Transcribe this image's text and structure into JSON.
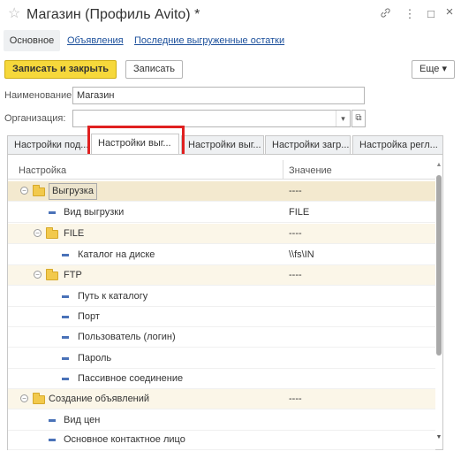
{
  "window": {
    "title": "Магазин (Профиль Avito) *",
    "star_icon": "☆",
    "link_icon": "🔗",
    "menu_icon": "⋮",
    "maximize_icon": "□",
    "close_icon": "×"
  },
  "nav": {
    "main": "Основное",
    "ads": "Объявления",
    "last_stock": "Последние выгруженные остатки"
  },
  "toolbar": {
    "save_close": "Записать и закрыть",
    "save": "Записать",
    "more": "Еще ▾"
  },
  "fields": {
    "name_label": "Наименование:",
    "name_value": "Магазин",
    "org_label": "Организация:",
    "org_value": "",
    "dropdown_icon": "▾",
    "open_icon": "⧉"
  },
  "tabs": [
    {
      "label": "Настройки под..."
    },
    {
      "label": "Настройки выг..."
    },
    {
      "label": "Настройки выг..."
    },
    {
      "label": "Настройки загр..."
    },
    {
      "label": "Настройка регл..."
    }
  ],
  "table": {
    "col_setting": "Настройка",
    "col_value": "Значение",
    "rows": [
      {
        "name": "Выгрузка",
        "value": "----",
        "kind": "group"
      },
      {
        "name": "Вид выгрузки",
        "value": "FILE",
        "kind": "item"
      },
      {
        "name": "FILE",
        "value": "----",
        "kind": "group"
      },
      {
        "name": "Каталог на диске",
        "value": "\\\\fs\\IN",
        "kind": "item"
      },
      {
        "name": "FTP",
        "value": "----",
        "kind": "group"
      },
      {
        "name": "Путь к каталогу",
        "value": "",
        "kind": "item"
      },
      {
        "name": "Порт",
        "value": "",
        "kind": "item"
      },
      {
        "name": "Пользователь (логин)",
        "value": "",
        "kind": "item"
      },
      {
        "name": "Пароль",
        "value": "",
        "kind": "item"
      },
      {
        "name": "Пассивное соединение",
        "value": "",
        "kind": "item"
      },
      {
        "name": "Создание объявлений",
        "value": "----",
        "kind": "group"
      },
      {
        "name": "Вид цен",
        "value": "",
        "kind": "item"
      },
      {
        "name": "Основное контактное лицо",
        "value": "",
        "kind": "item"
      }
    ]
  },
  "colors": {
    "accent_yellow": "#f6d83b",
    "link_blue": "#1b4f9b",
    "highlight_red": "#e02020",
    "folder": "#f2c94c"
  }
}
